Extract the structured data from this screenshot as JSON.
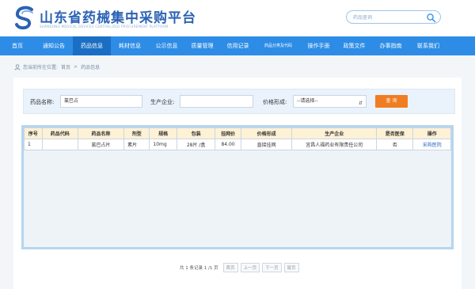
{
  "header": {
    "title": "山东省药械集中采购平台",
    "subtitle": "SHANDONG MEDICAL DEVICES CENTRALIZED PROCUREMENT PLATFORM",
    "search_placeholder": "药品查询",
    "brand_color": "#2b62b4"
  },
  "nav": {
    "items": [
      {
        "label": "首页",
        "active": false
      },
      {
        "label": "通知公告",
        "active": false
      },
      {
        "label": "药品信息",
        "active": true
      },
      {
        "label": "耗材信息",
        "active": false
      },
      {
        "label": "公示信息",
        "active": false
      },
      {
        "label": "质量管理",
        "active": false
      },
      {
        "label": "信用记录",
        "active": false
      },
      {
        "label": "药品分类及代码",
        "active": false
      },
      {
        "label": "操作手册",
        "active": false
      },
      {
        "label": "政策文件",
        "active": false
      },
      {
        "label": "办事指南",
        "active": false
      },
      {
        "label": "联系我们",
        "active": false
      }
    ],
    "bar_color": "#2d8ce6"
  },
  "breadcrumb": {
    "prefix": "您当前所在位置:",
    "home": "首页",
    "separator": ">",
    "current": "药品信息"
  },
  "search_form": {
    "drug_name_label": "药品名称:",
    "drug_name_value": "氯巴占",
    "manufacturer_label": "生产企业:",
    "manufacturer_value": "",
    "pricing_label": "价格形成:",
    "pricing_selected": "--请选择--",
    "query_button": "查 询",
    "button_color": "#f07d22"
  },
  "table": {
    "columns": [
      "序号",
      "药品代码",
      "药品名称",
      "剂型",
      "规格",
      "包装",
      "挂网价",
      "价格形成",
      "生产企业",
      "是否医保",
      "操作"
    ],
    "rows": [
      [
        "1",
        "",
        "氯巴占片",
        "素片",
        "10mg",
        "28片 /盒",
        "84.00",
        "直接挂网",
        "宜昌人福药业有限责任公司",
        "否",
        "采购医院"
      ]
    ]
  },
  "pagination": {
    "info": "共 1 条记录 1 /1 页",
    "first": "首页",
    "prev": "上一页",
    "next": "下一页",
    "last": "尾页"
  }
}
